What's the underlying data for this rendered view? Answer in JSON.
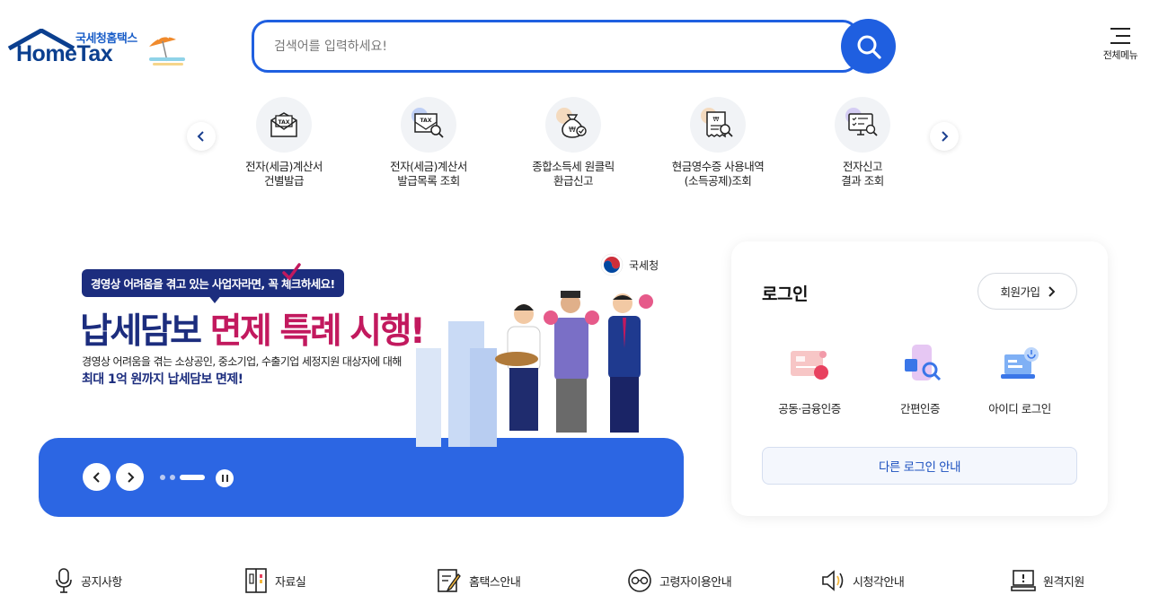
{
  "header": {
    "logo_ko": "국세청홈택스",
    "logo_en": "HomeTax",
    "search_placeholder": "검색어를 입력하세요!",
    "menu_label": "전체메뉴"
  },
  "quick_menu": [
    {
      "line1": "전자(세금)계산서",
      "line2": "건별발급",
      "icon": "tax-invoice-icon"
    },
    {
      "line1": "전자(세금)계산서",
      "line2": "발급목록 조회",
      "icon": "tax-search-icon"
    },
    {
      "line1": "종합소득세 원클릭",
      "line2": "환급신고",
      "icon": "money-bag-icon"
    },
    {
      "line1": "현금영수증 사용내역",
      "line2": "(소득공제)조회",
      "icon": "receipt-icon"
    },
    {
      "line1": "전자신고",
      "line2": "결과 조회",
      "icon": "monitor-check-icon"
    }
  ],
  "banner": {
    "agency": "국세청",
    "pill_prefix": "경영상 어려움을 겪고 있는 사업자라면,",
    "pill_em1": "꼭",
    "pill_em2": "체크",
    "pill_suffix": "하세요!",
    "headline_a": "납세담보",
    "headline_b": "면제 특례",
    "headline_c": "시행!",
    "sub1": "경영상 어려움을 겪는 소상공인, 중소기업, 수출기업 세정지원 대상자에 대해",
    "sub2": "최대 1억 원까지 납세담보 면제!",
    "slide_count": 3,
    "active_slide": 3
  },
  "login": {
    "title": "로그인",
    "join_label": "회원가입",
    "options": [
      {
        "label": "공동·금융인증",
        "icon": "certificate-icon"
      },
      {
        "label": "간편인증",
        "icon": "simple-auth-icon"
      },
      {
        "label": "아이디 로그인",
        "icon": "id-login-icon"
      }
    ],
    "other_label": "다른 로그인 안내"
  },
  "bottom_links": [
    {
      "label": "공지사항",
      "icon": "microphone-icon"
    },
    {
      "label": "자료실",
      "icon": "archive-icon"
    },
    {
      "label": "홈택스안내",
      "icon": "document-pen-icon"
    },
    {
      "label": "고령자이용안내",
      "icon": "glasses-icon"
    },
    {
      "label": "시청각안내",
      "icon": "speaker-icon"
    },
    {
      "label": "원격지원",
      "icon": "remote-support-icon"
    }
  ],
  "colors": {
    "primary": "#1f5fe0",
    "banner_blue": "#2c66e3",
    "navy": "#1c2d7e",
    "accent_pink": "#c2195e"
  }
}
